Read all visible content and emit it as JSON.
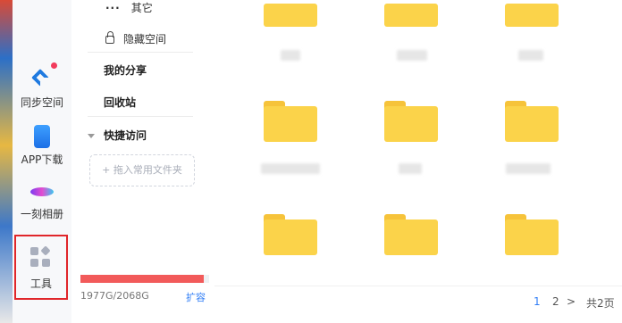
{
  "rail": {
    "items": [
      {
        "label": "同步空间",
        "icon": "sync-space-icon"
      },
      {
        "label": "APP下载",
        "icon": "phone-icon"
      },
      {
        "label": "一刻相册",
        "icon": "album-icon"
      },
      {
        "label": "工具",
        "icon": "tools-grid-icon"
      }
    ]
  },
  "nav": {
    "other_label": "其它",
    "hidden_space_label": "隐藏空间",
    "my_share_label": "我的分享",
    "recycle_bin_label": "回收站",
    "quick_access_label": "快捷访问",
    "add_folder_label": "+ 拖入常用文件夹",
    "storage": {
      "text": "1977G/2068G",
      "used_fraction": 0.956,
      "fill_color": "#f25a5a"
    },
    "expand_label": "扩容"
  },
  "main": {
    "folder_color": "#fbd34a"
  },
  "pager": {
    "page1": "1",
    "page2": "2",
    "next": ">",
    "total": "共2页"
  }
}
